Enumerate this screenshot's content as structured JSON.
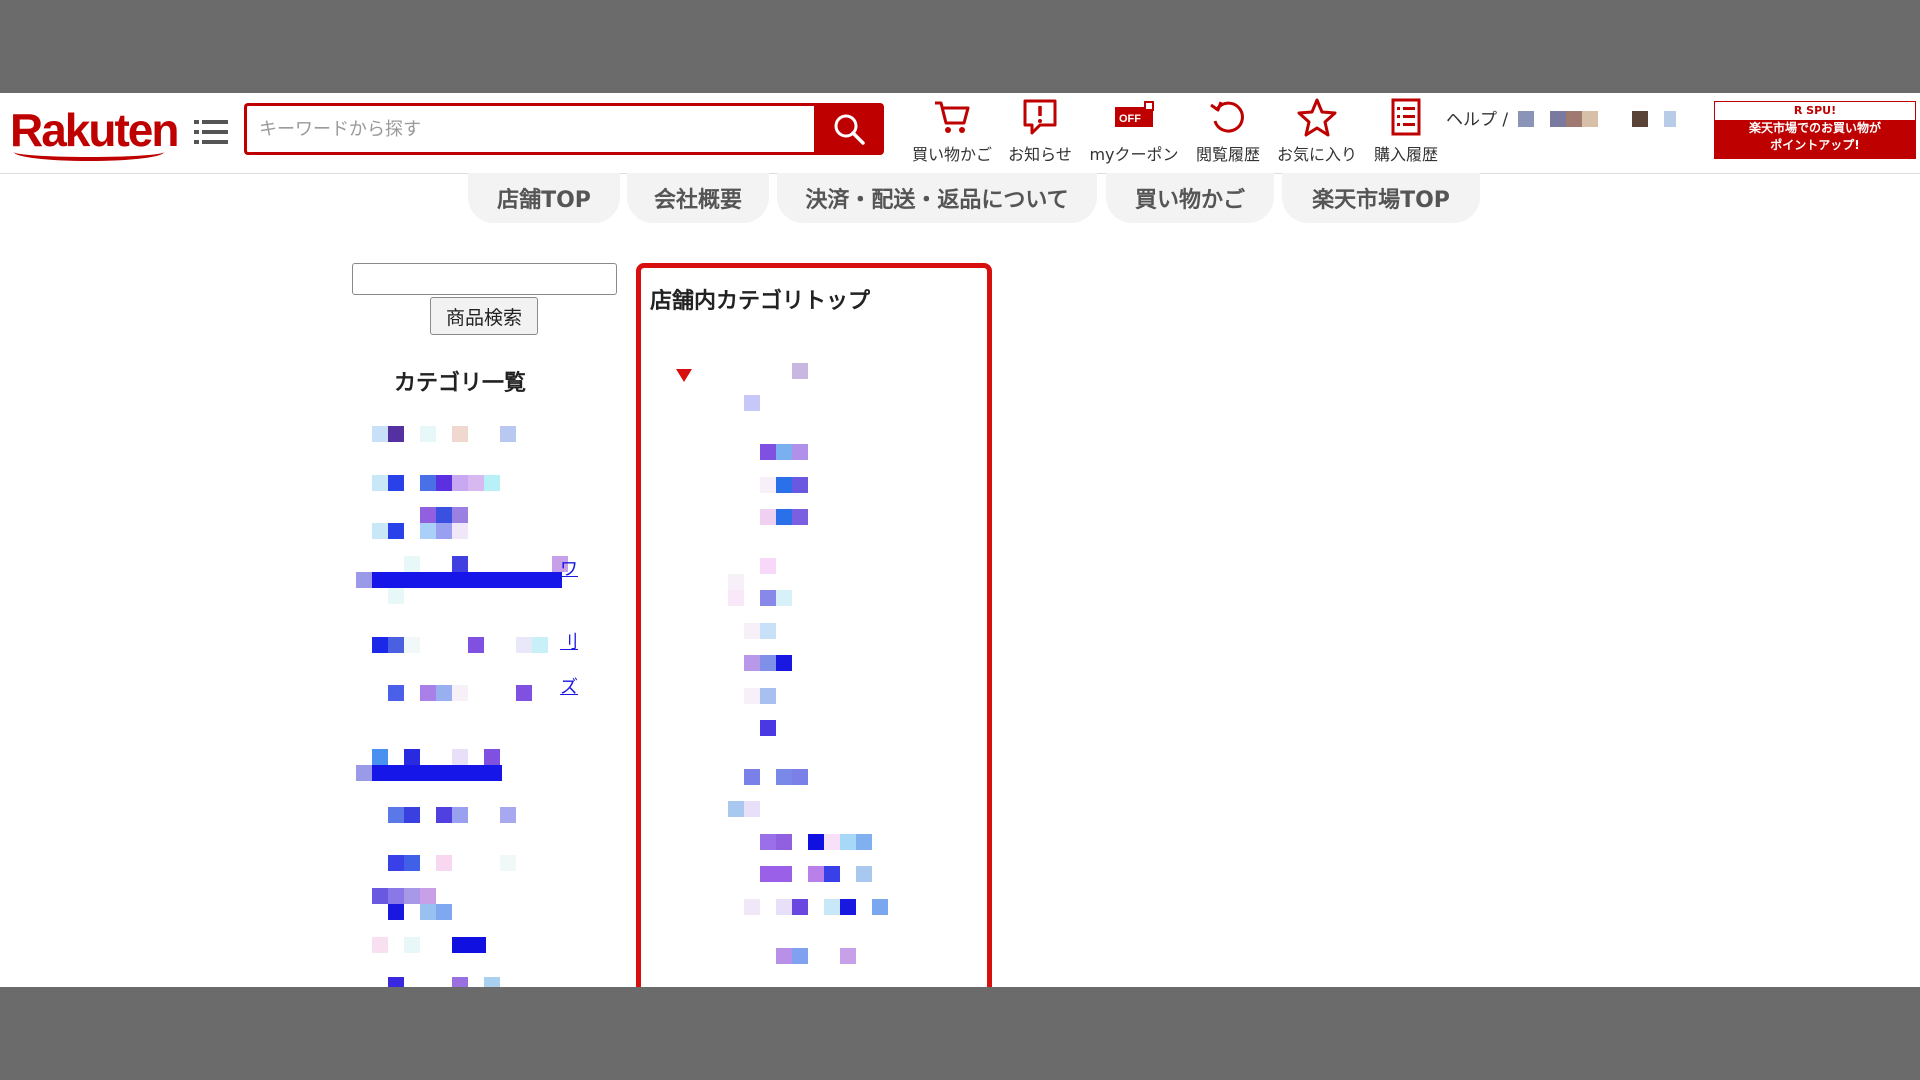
{
  "header": {
    "logo": "Rakuten",
    "search": {
      "placeholder": "キーワードから探す",
      "value": ""
    },
    "nav": [
      {
        "label": "買い物かご",
        "icon": "cart-icon"
      },
      {
        "label": "お知らせ",
        "icon": "notification-icon"
      },
      {
        "label": "myクーポン",
        "icon": "coupon-icon"
      },
      {
        "label": "閲覧履歴",
        "icon": "history-icon"
      },
      {
        "label": "お気に入り",
        "icon": "star-icon"
      },
      {
        "label": "購入履歴",
        "icon": "purchase-history-icon"
      }
    ],
    "coupon_badge": "OFF",
    "help": "ヘルプ /",
    "spu": {
      "top": "R SPU!",
      "line1": "楽天市場でのお買い物が",
      "line2": "ポイントアップ!"
    }
  },
  "tabs": [
    "店舗TOP",
    "会社概要",
    "決済・配送・返品について",
    "買い物かご",
    "楽天市場TOP"
  ],
  "sidebar": {
    "search_value": "",
    "search_button": "商品検索",
    "title": "カテゴリ一覧",
    "link_fragments": [
      "ワ",
      "刂",
      "ズ"
    ]
  },
  "category_panel": {
    "title": "店舗内カテゴリトップ"
  },
  "colors": {
    "brand": "#bf0000",
    "panel_border": "#d80f0f",
    "link": "#1a1ae0"
  }
}
